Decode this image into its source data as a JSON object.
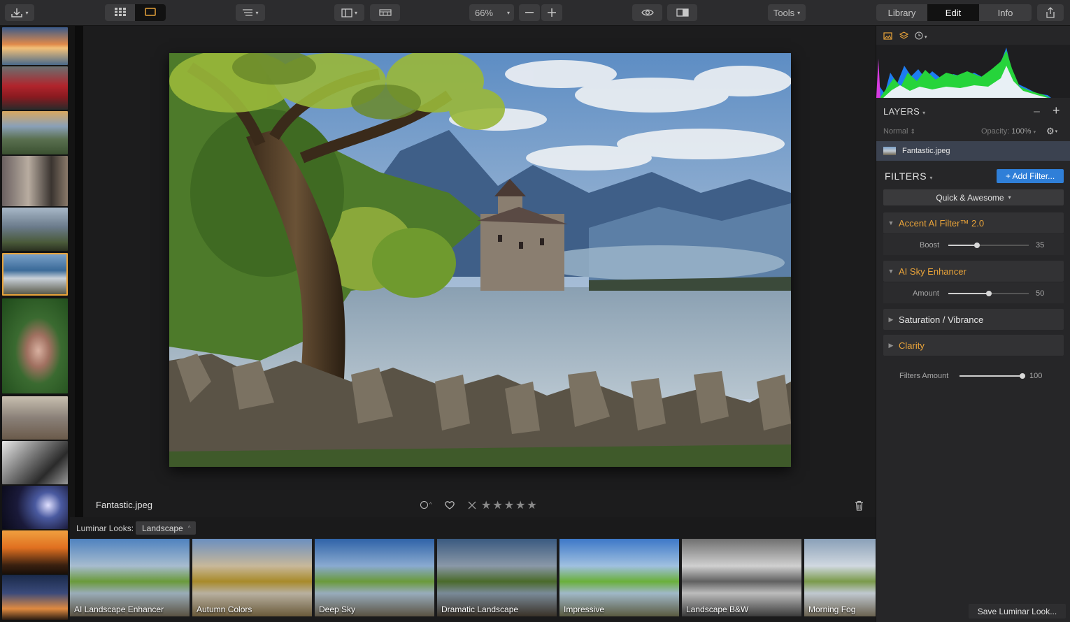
{
  "toolbar": {
    "zoom": "66%",
    "tools_label": "Tools",
    "tabs": [
      "Library",
      "Edit",
      "Info"
    ],
    "active_tab": "Edit"
  },
  "image": {
    "filename": "Fantastic.jpeg",
    "rating": 0
  },
  "looks": {
    "label": "Luminar Looks:",
    "category": "Landscape",
    "items": [
      "AI Landscape Enhancer",
      "Autumn Colors",
      "Deep Sky",
      "Dramatic Landscape",
      "Impressive",
      "Landscape B&W",
      "Morning Fog"
    ],
    "save_label": "Save Luminar Look..."
  },
  "layers": {
    "title": "LAYERS",
    "blend_mode": "Normal",
    "opacity_label": "Opacity:",
    "opacity": "100%",
    "items": [
      "Fantastic.jpeg"
    ]
  },
  "filters": {
    "title": "FILTERS",
    "add_label": "+ Add Filter...",
    "preset": "Quick & Awesome",
    "items": [
      {
        "name": "Accent AI Filter™ 2.0",
        "expanded": true,
        "param": "Boost",
        "value": 35
      },
      {
        "name": "AI Sky Enhancer",
        "expanded": true,
        "param": "Amount",
        "value": 50
      },
      {
        "name": "Saturation / Vibrance",
        "expanded": false
      },
      {
        "name": "Clarity",
        "expanded": false
      }
    ],
    "amount_label": "Filters Amount",
    "amount": 100
  },
  "colors": {
    "accent": "#e8a33a",
    "button_blue": "#2f7fd8",
    "panel": "#262628",
    "selected_layer": "#3b4250"
  }
}
